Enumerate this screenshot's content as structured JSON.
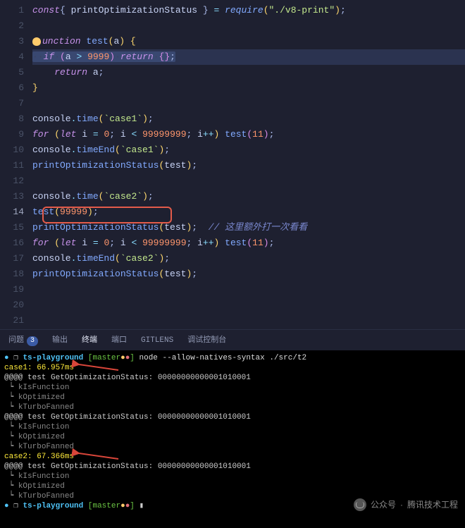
{
  "editor": {
    "lines": [
      "1",
      "2",
      "3",
      "4",
      "5",
      "6",
      "7",
      "8",
      "9",
      "10",
      "11",
      "12",
      "13",
      "14",
      "15",
      "16",
      "17",
      "18",
      "19",
      "20",
      "21"
    ],
    "active_line": "14"
  },
  "code": {
    "l1": {
      "const": "const",
      "destr_open": "{ ",
      "name": "printOptimizationStatus",
      "destr_close": " }",
      "eq": " = ",
      "require": "require",
      "po": "(",
      "str": "\"./v8-print\"",
      "pc": ")",
      "semi": ";"
    },
    "l3": {
      "fn": "unction",
      "name": " test",
      "po": "(",
      "arg": "a",
      "pc": ") ",
      "brace": "{"
    },
    "l4": {
      "ws": "··",
      "if": "if",
      "ws2": "·",
      "po": "(",
      "a": "a",
      "op": " > ",
      "num": "9999",
      "pc": ")",
      "ws3": "·",
      "ret": "return",
      "ws4": "·",
      "obj": "{}",
      "semi": ";"
    },
    "l5": {
      "ret": "    return",
      "a": " a",
      "semi": ";"
    },
    "l6": {
      "brace": "}"
    },
    "l8": {
      "obj": "console",
      "dot": ".",
      "fn": "time",
      "po": "(",
      "str": "`case1`",
      "pc": ")",
      "semi": ";"
    },
    "l9": {
      "for": "for",
      "po": " (",
      "let": "let",
      "i": " i",
      "eq": " = ",
      "z": "0",
      "semi1": ";",
      "i2": " i ",
      "lt": "<",
      "n": " 99999999",
      "semi2": ";",
      "i3": " i",
      "pp": "++",
      "pc": ") ",
      "fn": "test",
      "po2": "(",
      "arg": "11",
      "pc2": ")",
      "semi": ";"
    },
    "l10": {
      "obj": "console",
      "dot": ".",
      "fn": "timeEnd",
      "po": "(",
      "str": "`case1`",
      "pc": ")",
      "semi": ";"
    },
    "l11": {
      "fn": "printOptimizationStatus",
      "po": "(",
      "arg": "test",
      "pc": ")",
      "semi": ";"
    },
    "l13": {
      "obj": "console",
      "dot": ".",
      "fn": "time",
      "po": "(",
      "str": "`case2`",
      "pc": ")",
      "semi": ";"
    },
    "l14": {
      "fn": "test",
      "po": "(",
      "arg": "99999",
      "pc": ")",
      "semi": ";"
    },
    "l15": {
      "fn": "printOptimizationStatus",
      "po": "(",
      "arg": "test",
      "pc": ")",
      "semi": ";",
      "comment": "  // 这里额外打一次看看"
    },
    "l16": {
      "for": "for",
      "po": " (",
      "let": "let",
      "i": " i",
      "eq": " = ",
      "z": "0",
      "semi1": ";",
      "i2": " i ",
      "lt": "<",
      "n": " 99999999",
      "semi2": ";",
      "i3": " i",
      "pp": "++",
      "pc": ") ",
      "fn": "test",
      "po2": "(",
      "arg": "11",
      "pc2": ")",
      "semi": ";"
    },
    "l17": {
      "obj": "console",
      "dot": ".",
      "fn": "timeEnd",
      "po": "(",
      "str": "`case2`",
      "pc": ")",
      "semi": ";"
    },
    "l18": {
      "fn": "printOptimizationStatus",
      "po": "(",
      "arg": "test",
      "pc": ")",
      "semi": ";"
    }
  },
  "tabs": {
    "problems": "问题",
    "problems_count": "3",
    "output": "输出",
    "terminal": "终端",
    "ports": "端口",
    "gitlens": "GITLENS",
    "debug": "调试控制台"
  },
  "terminal": {
    "prompt1": {
      "dot": "● ",
      "icon": "❐ ",
      "path": "ts-playground",
      "bo": " [",
      "branch": "master",
      "dirty": "●",
      "red": "●",
      "bc": "]",
      "cmd": " node --allow-natives-syntax ./src/t2"
    },
    "case1": "case1: 66.957ms",
    "opt_header": "@@@@ test GetOptimizationStatus: 00000000000001010001",
    "f1": " ┕ kIsFunction",
    "f2": " ┕ kOptimized",
    "f3": " ┕ kTurboFanned",
    "case2": "case2: 67.366ms",
    "prompt2": {
      "dot": "● ",
      "icon": "❐ ",
      "path": "ts-playground",
      "bo": " [",
      "branch": "master",
      "dirty": "●",
      "red": "●",
      "bc": "]",
      "cursor": " ▮"
    }
  },
  "watermark": {
    "label": "公众号",
    "sep": " · ",
    "name": "腾讯技术工程"
  }
}
